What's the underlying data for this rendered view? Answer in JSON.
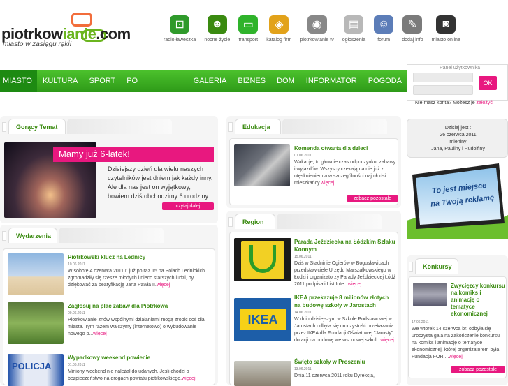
{
  "logo": {
    "part1": "piotrkow",
    "part2": "ianie",
    "suffix": ".com",
    "tagline": "miasto w zasięgu ręki!"
  },
  "topnav": [
    {
      "label": "radio ławeczka",
      "icon": "radio-icon",
      "color": "#2f9a2b"
    },
    {
      "label": "nocne życie",
      "icon": "nightlife-icon",
      "color": "#3a8a10"
    },
    {
      "label": "transport",
      "icon": "bus-icon",
      "color": "#2fb32b"
    },
    {
      "label": "katalog firm",
      "icon": "catalog-icon",
      "color": "#e2a21a"
    },
    {
      "label": "piotrkowianie tv",
      "icon": "tv-icon",
      "color": "#888888"
    },
    {
      "label": "ogłoszenia",
      "icon": "ads-icon",
      "color": "#b8b8b8"
    },
    {
      "label": "forum",
      "icon": "forum-icon",
      "color": "#5c7db8"
    },
    {
      "label": "dodaj info",
      "icon": "add-info-icon",
      "color": "#7b7b7b"
    },
    {
      "label": "miasto online",
      "icon": "camera-icon",
      "color": "#333333"
    }
  ],
  "menu": [
    "MIASTO",
    "KULTURA",
    "SPORT",
    "PO GODZINACH",
    "GALERIA",
    "BIZNES",
    "DOM",
    "INFORMATOR",
    "POGODA"
  ],
  "login": {
    "title": "Panel użytkownika",
    "ok": "OK"
  },
  "noaccount": {
    "text": "Nie masz konta? Możesz je",
    "link": "założyć"
  },
  "hot": {
    "tab": "Gorący Temat",
    "headline": "Mamy już 6-latek!",
    "text": "Dzisiejszy dzień dla wielu naszych czytelników jest dniem jak każdy inny. Ale dla nas jest on wyjątkowy, bowiem dziś obchodzimy 6 urodziny.",
    "more": "czytaj dalej"
  },
  "events": {
    "tab": "Wydarzenia",
    "items": [
      {
        "title": "Piotrkowski klucz na Lednicy",
        "date": "10.06.2011",
        "text": "W sobotę 4 czerwca 2011 r. już po raz 15 na Polach Lednickich zgromadziły się rzesze młodych i nieco starszych ludzi, by dziękować za beatyfikację Jana Pawła II.",
        "more": "więcej"
      },
      {
        "title": "Zagłosuj na plac zabaw dla Piotrkowa",
        "date": "09.06.2011",
        "text": "Piotrkowianie znów wspólnymi działaniami mogą zrobić coś dla miasta. Tym razem walczymy (internetowo) o wybudowanie nowego p...",
        "more": "więcej"
      },
      {
        "title": "Wypadkowy weekend powiecie",
        "date": "01.06.2011",
        "text": "Miniony weekend nie należał do udanych. Jeśli chodzi o bezpieczeństwo na drogach powiatu piotrkowskiego.",
        "more": "więcej"
      }
    ]
  },
  "education": {
    "tab": "Edukacja",
    "title": "Komenda otwarta dla dzieci",
    "date": "01.06.2011",
    "text": "Wakacje, to głownie czas odpoczynku, zabawy i wyjazdów. Wszyscy czekają na nie już z utęsknieniem a w szczególności najmłodsi mieszkańcy.",
    "more": "więcej",
    "button": "zobacz pozostałe"
  },
  "region": {
    "tab": "Region",
    "items": [
      {
        "title": "Parada Jeździecka na Łódzkim Szlaku Konnym",
        "date": "15.06.2011",
        "text": "Dziś w Stadninie Ogierów w Bogusławicach przedstawiciele Urzędu Marszałkowskiego w Łodzi i organizatorzy Parady Jeździeckiej Łódź 2011 podpisali List Inte...",
        "more": "więcej"
      },
      {
        "title": "IKEA przekazuje 8 milionów złotych na budowę szkoły w Jarostach",
        "date": "14.06.2011",
        "text": "W dniu dzisiejszym w Szkole Podstawowej w Jarostach odbyła się uroczystość przekazania przez IKEA dla Fundacji Oświatowej \"Jarosty\" dotacji na budowę we wsi nowej szkol...",
        "more": "więcej"
      },
      {
        "title": "Święto szkoły w Proszeniu",
        "date": "13.06.2011",
        "text": "Dnia 11 czerwca 2011 roku Dyrekcja,",
        "more": ""
      }
    ]
  },
  "today": {
    "line1": "Dzisiaj jest :",
    "line2": "26 czerwca 2011",
    "line3": "Imieniny:",
    "line4": "Jana, Pauliny i Rudolfiny"
  },
  "promo": {
    "text1": "To jest miejsce",
    "text2": "na Twoją reklamę"
  },
  "contest": {
    "tab": "Konkursy",
    "title": "Zwycięzcy konkursu na komiks i animację o tematyce ekonomicznej",
    "date": "17.06.2011",
    "text": "We wtorek 14 czerwca br. odbyła się uroczysta gala na zakończenie konkursu na komiks i animację o tematyce ekonomicznej, której organizatorem była Fundacja FOR ...",
    "more": "więcej",
    "button": "zobacz pozostałe"
  },
  "colors": {
    "green": "#3a8a10",
    "pink": "#e8187f",
    "menu_green": "#34a81c"
  }
}
